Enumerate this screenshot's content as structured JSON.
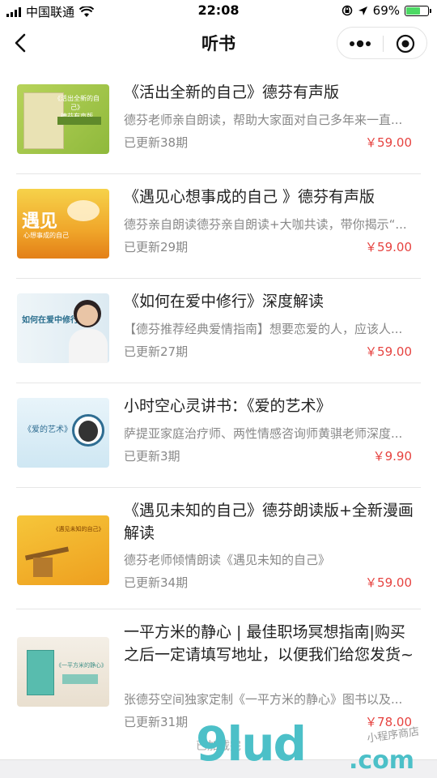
{
  "status": {
    "carrier": "中国联通",
    "time": "22:08",
    "battery": "69%",
    "battery_level": 0.69,
    "battery_color": "#4cd964"
  },
  "nav": {
    "title": "听书",
    "back_icon": "chevron-left-icon",
    "more_icon": "more-dots-icon",
    "close_icon": "target-close-icon"
  },
  "items": [
    {
      "title": "《活出全新的自己》德芬有声版",
      "desc": "德芬老师亲自朗读，帮助大家面对自己多年来一直...",
      "updated": "已更新38期",
      "price": "￥59.00"
    },
    {
      "title": "《遇见心想事成的自己 》德芬有声版",
      "desc": "德芬亲自朗读德芬亲自朗读+大咖共读，带你揭示“...",
      "updated": "已更新29期",
      "price": "￥59.00"
    },
    {
      "title": "《如何在爱中修行》深度解读",
      "desc": "【德芬推荐经典爱情指南】想要恋爱的人，应该人...",
      "updated": "已更新27期",
      "price": "￥59.00"
    },
    {
      "title": "小时空心灵讲书：《爱的艺术》",
      "desc": "萨提亚家庭治疗师、两性情感咨询师黄骐老师深度...",
      "updated": "已更新3期",
      "price": "￥9.90"
    },
    {
      "title": "《遇见未知的自己》德芬朗读版+全新漫画解读",
      "desc": "德芬老师倾情朗读《遇见未知的自己》",
      "updated": "已更新34期",
      "price": "￥59.00"
    },
    {
      "title": "一平方米的静心 | 最佳职场冥想指南|购买之后一定请填写地址，以便我们给您发货~",
      "desc": "张德芬空间独家定制《一平方米的静心》图书以及...",
      "updated": "已更新31期",
      "price": "￥78.00"
    }
  ],
  "thumbs": {
    "t1": {
      "line1": "《活出全新的自己》",
      "line2": "德芬有声版"
    },
    "t2": {
      "line1": "遇见",
      "line2": "心想事成的自己"
    },
    "t3": {
      "line1": "如何在爱中修行"
    },
    "t4": {
      "line1": "《爱的艺术》"
    },
    "t5": {
      "line1": "《遇见未知的自己》"
    },
    "t6": {
      "line1": "《一平方米的静心》"
    }
  },
  "footer": {
    "loaded": "已加载完"
  },
  "watermark": {
    "brand": "9lud",
    "domain": ".com",
    "sub": "小程序商店"
  },
  "colors": {
    "price": "#e64340",
    "meta": "#888888",
    "brand": "#4cc0c8"
  }
}
